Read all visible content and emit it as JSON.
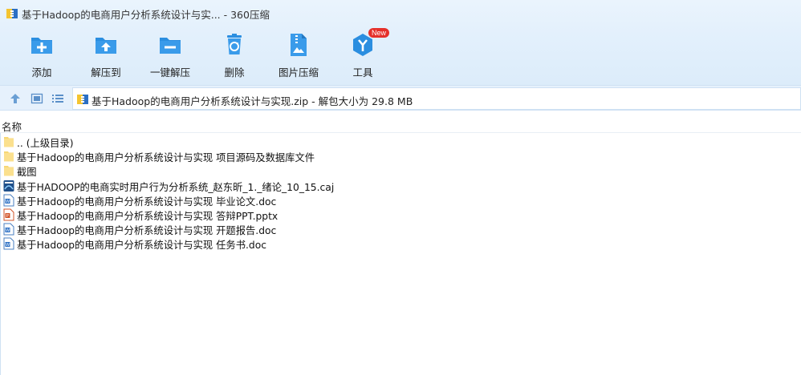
{
  "window": {
    "title": "基于Hadoop的电商用户分析系统设计与实... - 360压缩"
  },
  "toolbar": {
    "items": [
      {
        "label": "添加",
        "icon": "add-folder-icon"
      },
      {
        "label": "解压到",
        "icon": "extract-to-icon"
      },
      {
        "label": "一键解压",
        "icon": "one-click-extract-icon"
      },
      {
        "label": "删除",
        "icon": "recycle-bin-icon"
      },
      {
        "label": "图片压缩",
        "icon": "image-compress-icon"
      },
      {
        "label": "工具",
        "icon": "tools-icon",
        "badge": "New"
      }
    ]
  },
  "address": {
    "text": "基于Hadoop的电商用户分析系统设计与实现.zip - 解包大小为 29.8 MB"
  },
  "list": {
    "column_name": "名称",
    "rows": [
      {
        "name": ".. (上级目录)",
        "type": "folder"
      },
      {
        "name": "基于Hadoop的电商用户分析系统设计与实现 项目源码及数据库文件",
        "type": "folder"
      },
      {
        "name": "截图",
        "type": "folder"
      },
      {
        "name": "基于HADOOP的电商实时用户行为分析系统_赵东昕_1._绪论_10_15.caj",
        "type": "caj"
      },
      {
        "name": "基于Hadoop的电商用户分析系统设计与实现 毕业论文.doc",
        "type": "doc"
      },
      {
        "name": "基于Hadoop的电商用户分析系统设计与实现 答辩PPT.pptx",
        "type": "pptx"
      },
      {
        "name": "基于Hadoop的电商用户分析系统设计与实现 开题报告.doc",
        "type": "doc"
      },
      {
        "name": "基于Hadoop的电商用户分析系统设计与实现 任务书.doc",
        "type": "doc"
      }
    ]
  },
  "colors": {
    "accent_blue": "#2b8ee0",
    "toolbar_bg": "#e3f0fc",
    "folder_yellow": "#f7d774",
    "badge_red": "#e5302a"
  }
}
